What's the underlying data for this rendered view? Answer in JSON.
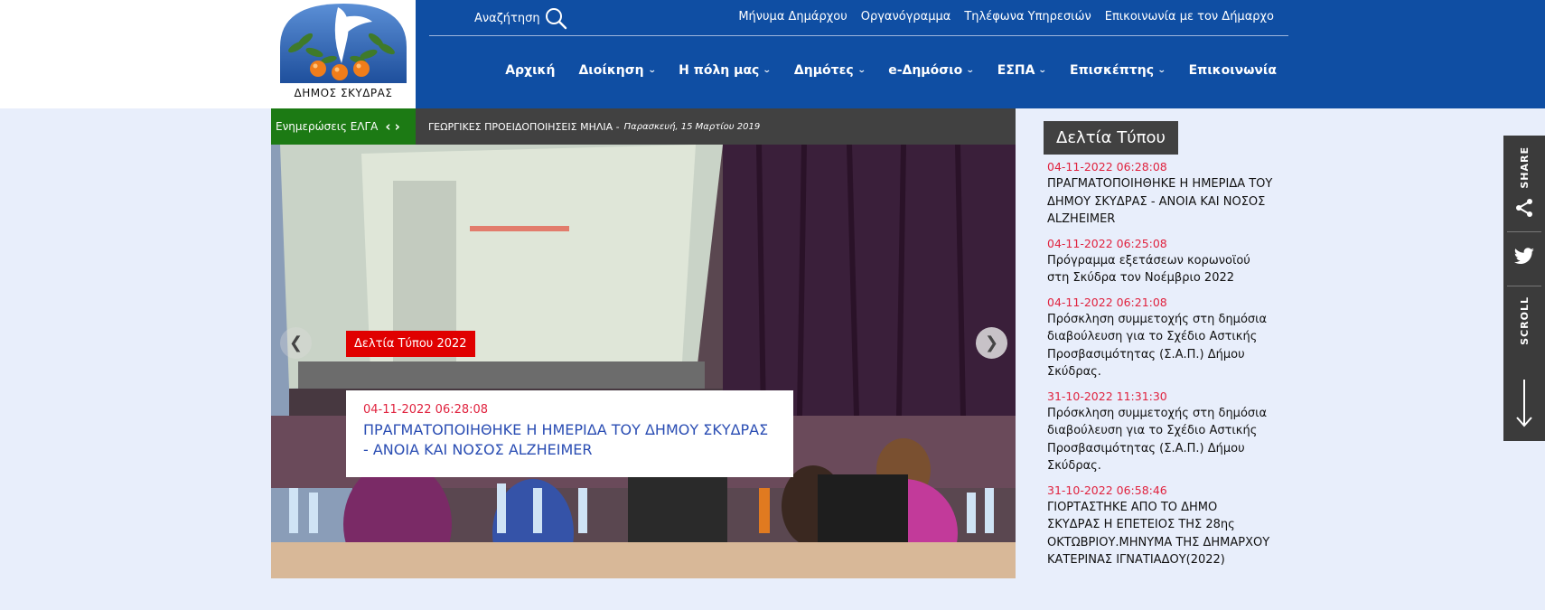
{
  "brand": {
    "logo_text": "ΔΗΜΟΣ ΣΚΥΔΡΑΣ"
  },
  "header": {
    "search_label": "Αναζήτηση",
    "top_links": [
      "Μήνυμα Δημάρχου",
      "Οργανόγραμμα",
      "Τηλέφωνα Υπηρεσιών",
      "Επικοινωνία με τον Δήμαρχο"
    ],
    "nav": [
      {
        "label": "Αρχική",
        "dropdown": false
      },
      {
        "label": "Διοίκηση",
        "dropdown": true
      },
      {
        "label": "Η πόλη μας",
        "dropdown": true
      },
      {
        "label": "Δημότες",
        "dropdown": true
      },
      {
        "label": "e-Δημόσιο",
        "dropdown": true
      },
      {
        "label": "ΕΣΠΑ",
        "dropdown": true
      },
      {
        "label": "Επισκέπτης",
        "dropdown": true
      },
      {
        "label": "Επικοινωνία",
        "dropdown": false
      }
    ]
  },
  "ticker": {
    "label": "Ενημερώσεις ΕΛΓΑ",
    "headline": "ΓΕΩΡΓΙΚΕΣ ΠΡΟΕΙΔΟΠΟΙΗΣΕΙΣ ΜΗΛΙΑ -",
    "date": "Παρασκευή, 15 Μαρτίου 2019"
  },
  "slider": {
    "tag": "Δελτία Τύπου 2022",
    "date": "04-11-2022 06:28:08",
    "title": "ΠΡΑΓΜΑΤΟΠΟΙΗΘΗΚΕ Η ΗΜΕΡΙΔΑ ΤΟΥ ΔΗΜΟΥ ΣΚΥΔΡΑΣ - ΑΝΟΙΑ ΚΑΙ ΝΟΣΟΣ ALZHEIMER",
    "prev_icon": "chevron-left-icon",
    "next_icon": "chevron-right-icon"
  },
  "press": {
    "heading": "Δελτία Τύπου",
    "items": [
      {
        "date": "04-11-2022 06:28:08",
        "title": "ΠΡΑΓΜΑΤΟΠΟΙΗΘΗΚΕ Η ΗΜΕΡΙΔΑ ΤΟΥ ΔΗΜΟΥ ΣΚΥΔΡΑΣ - ΑΝΟΙΑ ΚΑΙ ΝΟΣΟΣ ALZHEIMER"
      },
      {
        "date": "04-11-2022 06:25:08",
        "title": "Πρόγραμμα εξετάσεων κορωνοϊού στη Σκύδρα τον Νοέμβριο 2022"
      },
      {
        "date": "04-11-2022 06:21:08",
        "title": "Πρόσκληση συμμετοχής στη δημόσια διαβούλευση για το Σχέδιο Αστικής Προσβασιμότητας (Σ.Α.Π.) Δήμου Σκύδρας."
      },
      {
        "date": "31-10-2022 11:31:30",
        "title": "Πρόσκληση συμμετοχής στη δημόσια διαβούλευση για το Σχέδιο Αστικής Προσβασιμότητας (Σ.Α.Π.) Δήμου Σκύδρας."
      },
      {
        "date": "31-10-2022 06:58:46",
        "title": "ΓΙΟΡΤΑΣΤΗΚΕ ΑΠΟ ΤΟ ΔΗΜΟ ΣΚΥΔΡΑΣ Η ΕΠΕΤΕΙΟΣ ΤΗΣ 28ης ΟΚΤΩΒΡΙΟΥ.ΜΗΝΥΜΑ ΤΗΣ ΔΗΜΑΡΧΟΥ ΚΑΤΕΡΙΝΑΣ ΙΓΝΑΤΙΑΔΟΥ(2022)"
      }
    ]
  },
  "share_bar": {
    "share_label": "SHARE",
    "scroll_label": "SCROLL"
  },
  "colors": {
    "header_blue": "#0f4ea3",
    "page_bg": "#e8eefb",
    "ticker_green": "#1c7a14",
    "accent_red": "#e0223e",
    "tag_red": "#e00000",
    "dark_gray": "#414141"
  }
}
